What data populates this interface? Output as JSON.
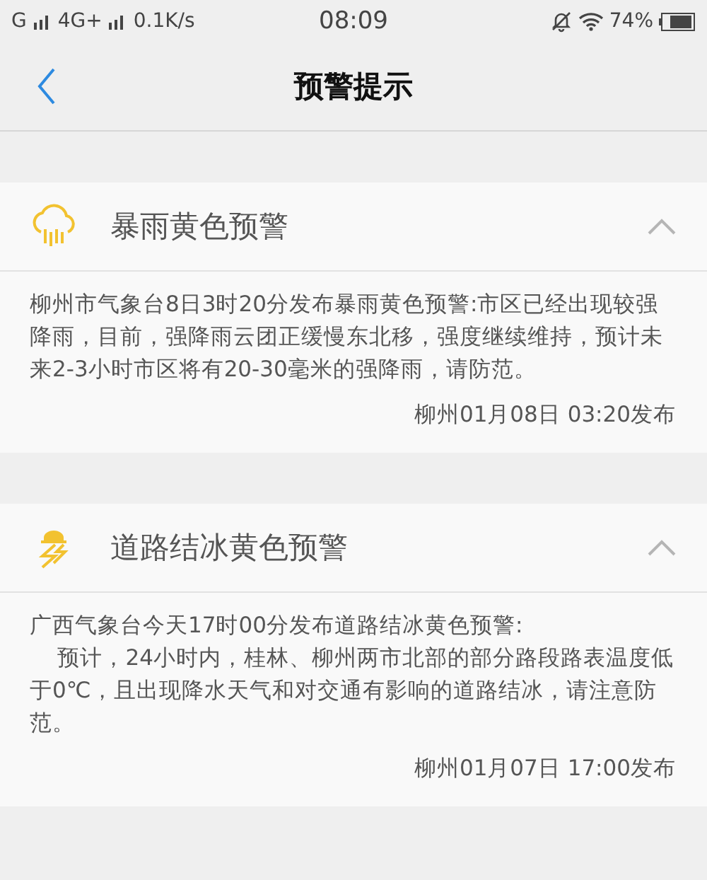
{
  "status_bar": {
    "network_1": "G",
    "network_2": "4G+",
    "speed": "0.1K/s",
    "time": "08:09",
    "battery": "74%"
  },
  "header": {
    "title": "预警提示"
  },
  "alerts": [
    {
      "kind": "rain",
      "title": "暴雨黄色预警",
      "expanded": true,
      "body": "柳州市气象台8日3时20分发布暴雨黄色预警:市区已经出现较强降雨，目前，强降雨云团正缓慢东北移，强度继续维持，预计未来2-3小时市区将有20-30毫米的强降雨，请防范。",
      "issued": "柳州01月08日 03:20发布"
    },
    {
      "kind": "ice",
      "title": "道路结冰黄色预警",
      "expanded": true,
      "body": "广西气象台今天17时00分发布道路结冰黄色预警:\n    预计，24小时内，桂林、柳州两市北部的部分路段路表温度低于0℃，且出现降水天气和对交通有影响的道路结冰，请注意防范。",
      "issued": "柳州01月07日 17:00发布"
    }
  ]
}
